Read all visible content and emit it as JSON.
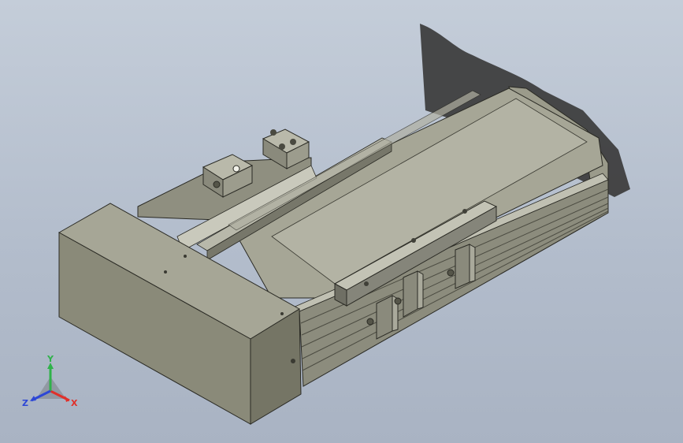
{
  "view": {
    "colors": {
      "background_top": "#c4cdd9",
      "background_bottom": "#a9b3c3",
      "housing_front": "#8a8a79",
      "housing_top": "#a6a696",
      "housing_side": "#757565",
      "rail": "#aeaea0",
      "rail_dark": "#6e6e62",
      "edge": "#2a2a24",
      "shadow": "#3b3b3b"
    }
  },
  "triad": {
    "x_label": "X",
    "y_label": "Y",
    "z_label": "Z",
    "x_color": "#e0302a",
    "y_color": "#2fb24a",
    "z_color": "#2d47d6"
  }
}
